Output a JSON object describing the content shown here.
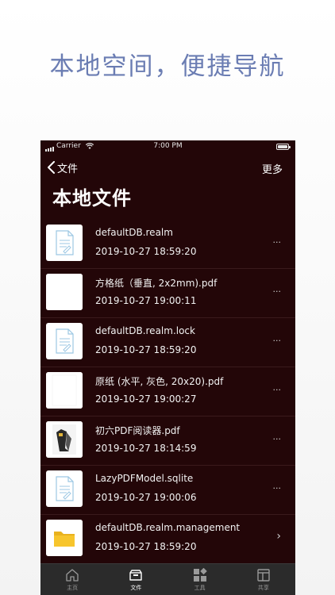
{
  "headline": "本地空间，便捷导航",
  "status": {
    "carrier": "Carrier",
    "time": "7:00 PM"
  },
  "nav": {
    "back_label": "文件",
    "more_label": "更多"
  },
  "page_title": "本地文件",
  "files": [
    {
      "name": "defaultDB.realm",
      "date": "2019-10-27 18:59:20",
      "thumb": "document-icon",
      "accessory": "···"
    },
    {
      "name": "方格纸（垂直, 2x2mm).pdf",
      "date": "2019-10-27 19:00:11",
      "thumb": "blank-page-icon",
      "accessory": "···"
    },
    {
      "name": "defaultDB.realm.lock",
      "date": "2019-10-27 18:59:20",
      "thumb": "document-icon",
      "accessory": "···"
    },
    {
      "name": "原纸 (水平, 灰色, 20x20).pdf",
      "date": "2019-10-27 19:00:27",
      "thumb": "blank-page-icon",
      "accessory": "···"
    },
    {
      "name": "初六PDF阅读器.pdf",
      "date": "2019-10-27 18:14:59",
      "thumb": "pdf-cover-thumbnail",
      "accessory": "···"
    },
    {
      "name": "LazyPDFModel.sqlite",
      "date": "2019-10-27 19:00:06",
      "thumb": "document-icon",
      "accessory": "···"
    },
    {
      "name": "defaultDB.realm.management",
      "date": "2019-10-27 18:59:20",
      "thumb": "folder-icon",
      "accessory": "›"
    }
  ],
  "tabs": [
    {
      "label": "主页",
      "icon": "home-icon",
      "active": false
    },
    {
      "label": "文件",
      "icon": "file-box-icon",
      "active": true
    },
    {
      "label": "工具",
      "icon": "tools-grid-icon",
      "active": false
    },
    {
      "label": "共享",
      "icon": "share-layout-icon",
      "active": false
    }
  ],
  "colors": {
    "headline": "#6b7db3",
    "screen_bg": "#230608",
    "tabbar_bg": "#2b2b2b",
    "folder": "#f7c52c"
  }
}
